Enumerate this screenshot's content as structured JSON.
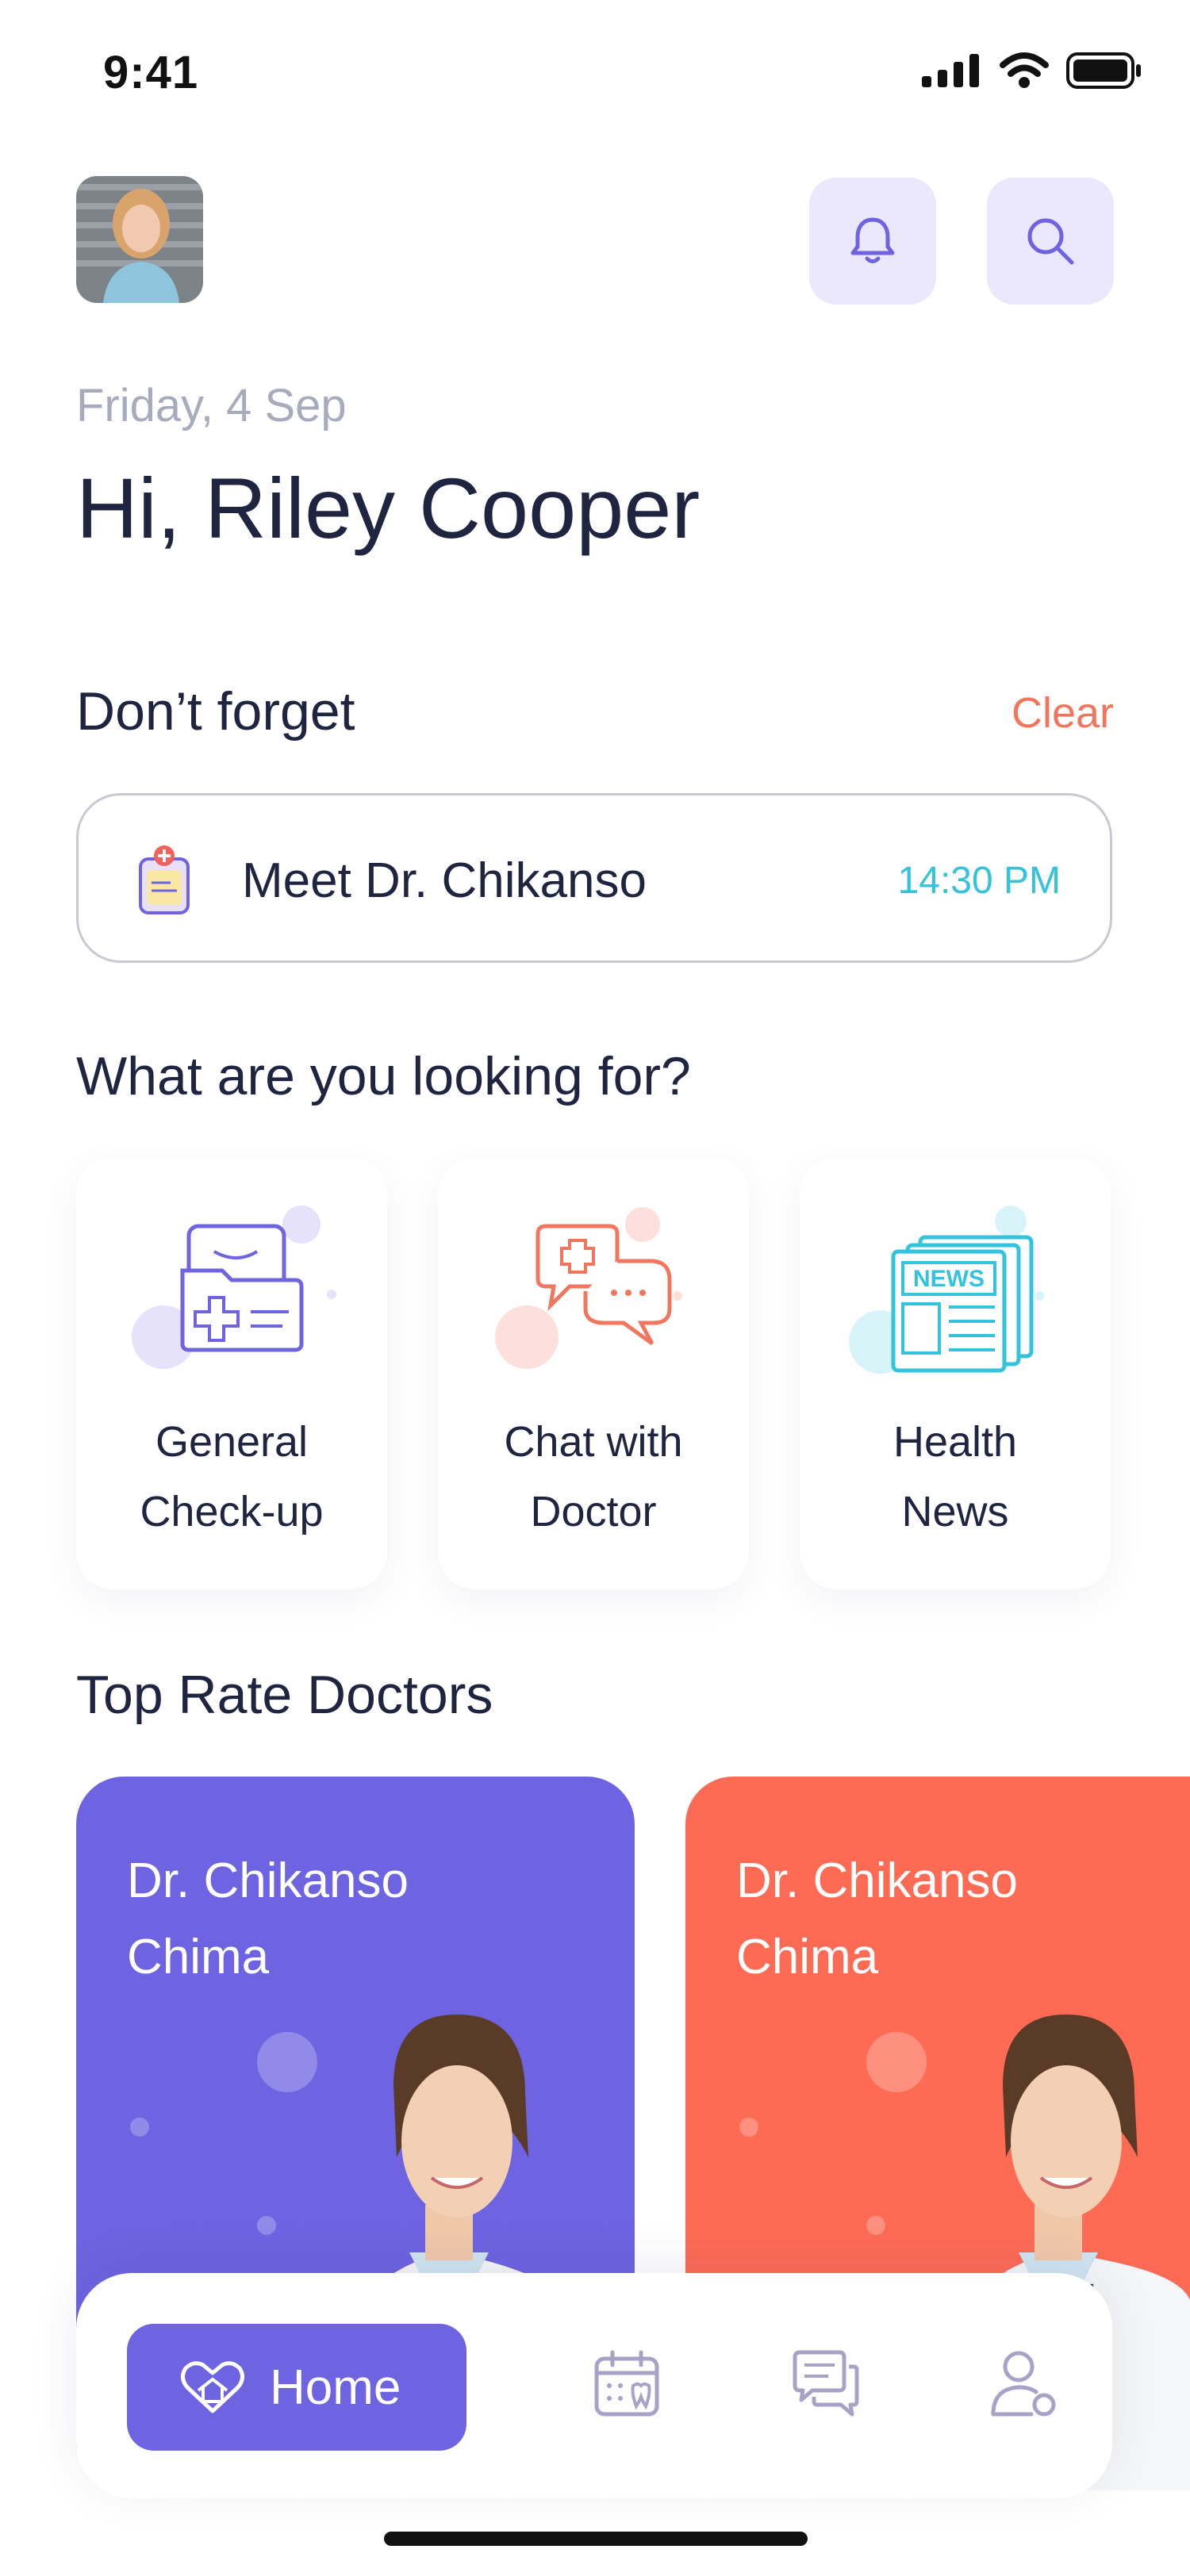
{
  "status_bar": {
    "time": "9:41",
    "icons": [
      "signal-icon",
      "wifi-icon",
      "battery-icon"
    ]
  },
  "header": {
    "avatar": "user-avatar",
    "bell_icon": "bell-icon",
    "search_icon": "search-icon"
  },
  "greeting": {
    "date": "Friday, 4 Sep",
    "text": "Hi, Riley Cooper"
  },
  "reminders": {
    "title": "Don’t forget",
    "clear_label": "Clear",
    "items": [
      {
        "icon": "clipboard-medical-icon",
        "title": "Meet Dr. Chikanso",
        "time": "14:30 PM"
      }
    ]
  },
  "services": {
    "title": "What are you looking for?",
    "items": [
      {
        "label_line1": "General",
        "label_line2": "Check-up",
        "icon": "medical-folder-icon"
      },
      {
        "label_line1": "Chat with",
        "label_line2": "Doctor",
        "icon": "medical-chat-icon"
      },
      {
        "label_line1": "Health",
        "label_line2": "News",
        "icon": "newspaper-icon",
        "icon_text": "NEWS"
      }
    ]
  },
  "doctors": {
    "title": "Top Rate Doctors",
    "items": [
      {
        "name_line1": "Dr. Chikanso",
        "name_line2": "Chima",
        "color": "#6e63e0"
      },
      {
        "name_line1": "Dr. Chikanso",
        "name_line2": "Chima",
        "color": "#fd6b55"
      }
    ]
  },
  "nav": {
    "home_label": "Home",
    "items": [
      "home-heart-icon",
      "calendar-tooth-icon",
      "chat-icon",
      "profile-icon"
    ]
  },
  "colors": {
    "primary": "#6e63e0",
    "accent": "#f2765d",
    "teal": "#33c3dc",
    "text": "#1f2540",
    "muted": "#a7abbb"
  }
}
